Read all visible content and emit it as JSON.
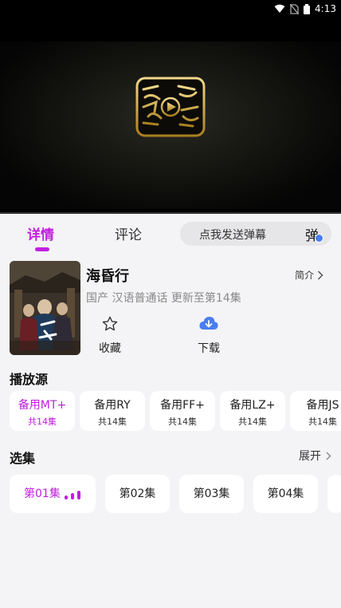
{
  "status_bar": {
    "time": "4:13",
    "icons": [
      "wifi-icon",
      "no-sim-icon",
      "battery-icon"
    ]
  },
  "player": {
    "logo_text": "网络视听",
    "progress": 0
  },
  "tabs": {
    "details": "详情",
    "comments": "评论"
  },
  "danmaku": {
    "placeholder": "点我发送弹幕",
    "icon_char": "弹"
  },
  "show": {
    "title": "海昏行",
    "intro_label": "简介",
    "meta": "国产 汉语普通话 更新至第14集",
    "favorite_label": "收藏",
    "download_label": "下载"
  },
  "sources": {
    "title": "播放源",
    "items": [
      {
        "name": "备用MT+",
        "count": "共14集",
        "active": true
      },
      {
        "name": "备用RY",
        "count": "共14集",
        "active": false
      },
      {
        "name": "备用FF+",
        "count": "共14集",
        "active": false
      },
      {
        "name": "备用LZ+",
        "count": "共14集",
        "active": false
      },
      {
        "name": "备用JS",
        "count": "共14集",
        "active": false
      }
    ]
  },
  "episodes": {
    "title": "选集",
    "expand_label": "展开",
    "items": [
      {
        "name": "第01集",
        "active": true
      },
      {
        "name": "第02集",
        "active": false
      },
      {
        "name": "第03集",
        "active": false
      },
      {
        "name": "第04集",
        "active": false
      }
    ]
  },
  "colors": {
    "accent": "#c21ee0",
    "download": "#4a7df0",
    "background": "#f4f4f6"
  }
}
